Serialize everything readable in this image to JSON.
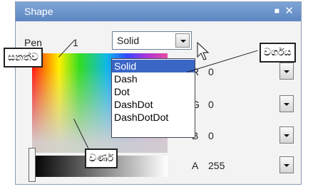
{
  "window": {
    "title": "Shape",
    "pin_glyph": "■",
    "close_glyph": "✕"
  },
  "pen": {
    "label": "Pen",
    "width": "1"
  },
  "style_combo": {
    "value": "Solid"
  },
  "dropdown": {
    "options": [
      "Solid",
      "Dash",
      "Dot",
      "DashDot",
      "DashDotDot"
    ],
    "selected_index": 0
  },
  "channels": [
    {
      "label": "R",
      "value": "0"
    },
    {
      "label": "G",
      "value": "0"
    },
    {
      "label": "B",
      "value": "0"
    },
    {
      "label": "A",
      "value": "255"
    }
  ],
  "callouts": {
    "thickness": "සනත්ව",
    "type": "වර්ගය",
    "color": "වර්ණ"
  },
  "colors": {
    "titlebar": "#6b92cb",
    "selection": "#3a66c6"
  }
}
